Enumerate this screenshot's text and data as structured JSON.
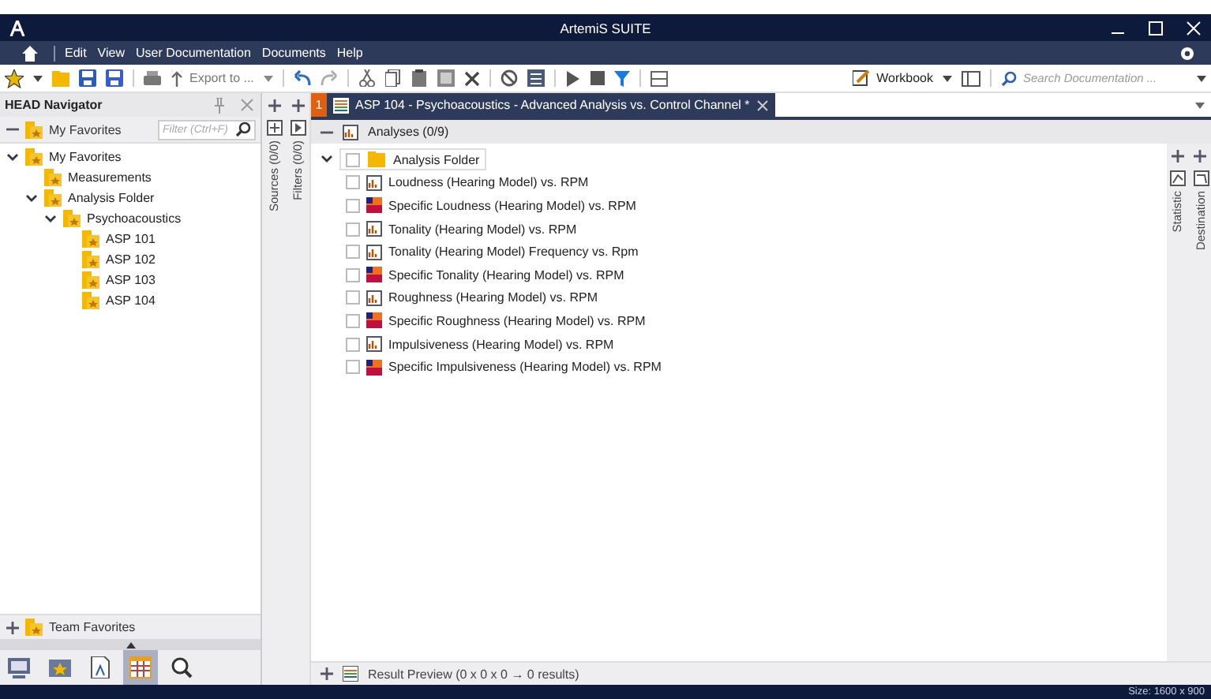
{
  "window": {
    "title": "ArtemiS SUITE"
  },
  "menu": [
    "Edit",
    "View",
    "User Documentation",
    "Documents",
    "Help"
  ],
  "toolbar": {
    "export_label": "Export to ...",
    "workbook_label": "Workbook",
    "search_placeholder": "Search Documentation ..."
  },
  "navigator": {
    "title": "HEAD Navigator",
    "filter_placeholder": "Filter (Ctrl+F)",
    "favorites_label": "My Favorites",
    "tree": [
      {
        "label": "My Favorites",
        "expanded": true,
        "children": [
          {
            "label": "Measurements"
          },
          {
            "label": "Analysis Folder",
            "expanded": true,
            "children": [
              {
                "label": "Psychoacoustics",
                "expanded": true,
                "children": [
                  {
                    "label": "ASP 101"
                  },
                  {
                    "label": "ASP 102"
                  },
                  {
                    "label": "ASP 103"
                  },
                  {
                    "label": "ASP 104"
                  }
                ]
              }
            ]
          }
        ]
      }
    ],
    "team_favorites": "Team Favorites"
  },
  "document_tab": {
    "number": "1",
    "title": "ASP 104 - Psychoacoustics - Advanced Analysis  vs. Control Channel *",
    "selected": true
  },
  "side_labels": [
    "Sources (0/0)",
    "Filters (0/0)"
  ],
  "analyses": {
    "header": "Analyses (0/9)",
    "folder": {
      "label": "Analysis Folder",
      "checked": false,
      "expanded": true
    },
    "items": [
      {
        "label": "Loudness (Hearing Model) vs. RPM",
        "kind": "curve",
        "checked": false
      },
      {
        "label": "Specific Loudness (Hearing Model) vs. RPM",
        "kind": "spectrum",
        "checked": false
      },
      {
        "label": "Tonality (Hearing Model) vs. RPM",
        "kind": "curve",
        "checked": false
      },
      {
        "label": "Tonality (Hearing Model) Frequency vs. Rpm",
        "kind": "curve",
        "checked": false
      },
      {
        "label": "Specific Tonality (Hearing Model) vs. RPM",
        "kind": "spectrum",
        "checked": false
      },
      {
        "label": "Roughness (Hearing Model) vs. RPM",
        "kind": "curve",
        "checked": false
      },
      {
        "label": "Specific Roughness (Hearing Model) vs. RPM",
        "kind": "spectrum",
        "checked": false
      },
      {
        "label": "Impulsiveness (Hearing Model) vs. RPM",
        "kind": "curve",
        "checked": false
      },
      {
        "label": "Specific Impulsiveness (Hearing Model) vs. RPM",
        "kind": "spectrum",
        "checked": false
      }
    ]
  },
  "right_labels": [
    "Statistic",
    "Destination"
  ],
  "result_preview": "Result Preview (0 x 0 x 0 → 0 results)",
  "status_bar": "Size: 1600 x 900"
}
